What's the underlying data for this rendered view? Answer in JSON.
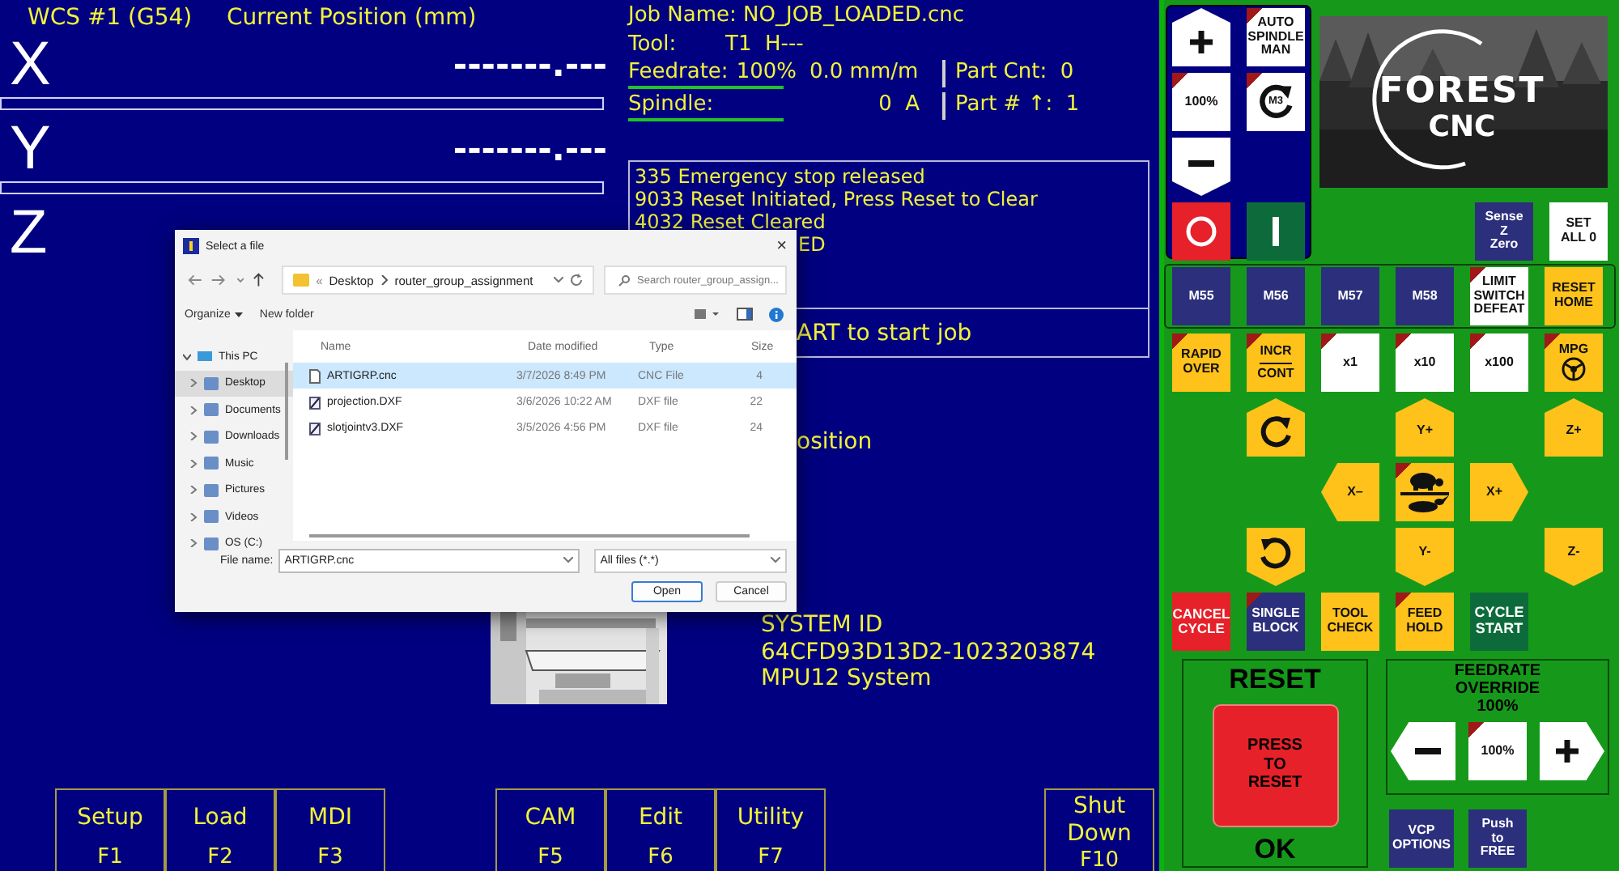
{
  "dro": {
    "wcs": "WCS #1 (G54)",
    "title": "Current Position (mm)",
    "axes": [
      {
        "label": "X",
        "value": "-------.---"
      },
      {
        "label": "Y",
        "value": "-------.---"
      },
      {
        "label": "Z"
      }
    ]
  },
  "job": {
    "name": "Job Name: NO_JOB_LOADED.cnc",
    "tool_label": "Tool:",
    "tool": "T1  H---",
    "feed_label": "Feedrate:",
    "feed_pct": "100%",
    "feed_rate": "0.0 mm/m",
    "part_cnt": "Part Cnt:  0",
    "spindle_label": "Spindle:",
    "spindle": "0  A",
    "part_no": "Part # ↑:  1"
  },
  "messages": [
    {
      "text": "335 Emergency stop released",
      "clipped_left": false
    },
    {
      "text": "9033 Reset Initiated, Press Reset to Clear",
      "clipped_left": false
    },
    {
      "text": "4032 Reset Cleared",
      "clipped_left": false
    },
    {
      "text": "ED",
      "clipped_left": true
    }
  ],
  "status": {
    "text": "ART to start job",
    "clipped_left": true
  },
  "prompt": {
    "text": "osition",
    "clipped_left": true
  },
  "system": [
    "SYSTEM ID",
    "64CFD93D13D2-1023203874",
    "MPU12 System"
  ],
  "fkey_groups": [
    [
      {
        "label": "Setup",
        "key": "F1"
      },
      {
        "label": "Load",
        "key": "F2"
      },
      {
        "label": "MDI",
        "key": "F3"
      }
    ],
    [
      {
        "label": "CAM",
        "key": "F5"
      },
      {
        "label": "Edit",
        "key": "F6"
      },
      {
        "label": "Utility",
        "key": "F7"
      }
    ],
    [
      {
        "label": "Shut Down",
        "key": "F10"
      }
    ]
  ],
  "dialog": {
    "title": "Select a file",
    "close": "×",
    "path_prefix": "«",
    "path": [
      "Desktop",
      "router_group_assignment"
    ],
    "search_placeholder": "Search router_group_assign...",
    "toolbar": [
      "Organize",
      "New folder"
    ],
    "nav": [
      {
        "label": "This PC",
        "expanded": true,
        "selected": false,
        "children": [
          {
            "label": "Desktop",
            "expanded": false,
            "selected": true
          },
          {
            "label": "Documents",
            "expanded": false,
            "selected": false
          },
          {
            "label": "Downloads",
            "expanded": false,
            "selected": false
          },
          {
            "label": "Music",
            "expanded": false,
            "selected": false
          },
          {
            "label": "Pictures",
            "expanded": false,
            "selected": false
          },
          {
            "label": "Videos",
            "expanded": false,
            "selected": false
          },
          {
            "label": "OS (C:)",
            "expanded": false,
            "selected": false
          }
        ]
      }
    ],
    "columns": [
      "Name",
      "Date modified",
      "Type",
      "Size"
    ],
    "files": [
      {
        "name": "ARTIGRP.cnc",
        "date": "3/7/2026 8:49 PM",
        "type": "CNC File",
        "size": "4",
        "kind": "cnc",
        "selected": true
      },
      {
        "name": "projection.DXF",
        "date": "3/6/2026 10:22 AM",
        "type": "DXF file",
        "size": "22",
        "kind": "dxf",
        "selected": false
      },
      {
        "name": "slotjointv3.DXF",
        "date": "3/5/2026 4:56 PM",
        "type": "DXF file",
        "size": "24",
        "kind": "dxf",
        "selected": false
      }
    ],
    "file_name_label": "File name:",
    "file_name": "ARTIGRP.cnc",
    "filter": "All files (*.*)",
    "buttons": [
      "Open",
      "Cancel"
    ]
  },
  "spindle_pad": [
    {
      "kind": "increase"
    },
    {
      "kind": "toggle",
      "lines": [
        "AUTO",
        "SPINDLE",
        "MAN"
      ],
      "indicator": true
    },
    {
      "kind": "toggle",
      "lines": [
        "100%"
      ],
      "indicator": true
    },
    {
      "kind": "spindledir",
      "lines": [
        "M3"
      ],
      "indicator": true
    },
    {
      "kind": "decrease"
    },
    {
      "kind": "off",
      "indicator": false
    },
    {
      "kind": "on",
      "indicator": false
    }
  ],
  "logo": {
    "lines": [
      "FOREST",
      "CNC"
    ]
  },
  "zero_buttons": [
    {
      "kind": "option",
      "lines": [
        "Sense",
        "Z",
        "Zero"
      ],
      "indicator": false
    },
    {
      "kind": "toggle",
      "lines": [
        "SET",
        "ALL 0"
      ],
      "indicator": false
    }
  ],
  "m_buttons": [
    {
      "kind": "option",
      "lines": [
        "M55"
      ],
      "indicator": false
    },
    {
      "kind": "option",
      "lines": [
        "M56"
      ],
      "indicator": false
    },
    {
      "kind": "option",
      "lines": [
        "M57"
      ],
      "indicator": false
    },
    {
      "kind": "option",
      "lines": [
        "M58"
      ],
      "indicator": false
    },
    {
      "kind": "toggle",
      "lines": [
        "LIMIT",
        "SWITCH",
        "DEFEAT"
      ],
      "indicator": true
    },
    {
      "kind": "action",
      "lines": [
        "RESET",
        "HOME"
      ],
      "indicator": false
    }
  ],
  "jog_rows": [
    [
      {
        "kind": "action",
        "lines": [
          "RAPID",
          "OVER"
        ],
        "indicator": true
      },
      {
        "kind": "ratio",
        "lines": [
          "INCR",
          "CONT"
        ],
        "indicator": true
      },
      {
        "kind": "toggle",
        "lines": [
          "x1"
        ],
        "indicator": true
      },
      {
        "kind": "toggle",
        "lines": [
          "x10"
        ],
        "indicator": true
      },
      {
        "kind": "toggle",
        "lines": [
          "x100"
        ],
        "indicator": true
      },
      {
        "kind": "handwheel",
        "lines": [
          "MPG"
        ],
        "indicator": true
      }
    ],
    [
      {
        "kind": "rotatecw"
      },
      {
        "kind": "jogup",
        "lines": [
          "Y+"
        ]
      },
      {
        "kind": "jogup",
        "lines": [
          "Z+"
        ]
      }
    ],
    [
      {
        "kind": "jogleft",
        "lines": [
          "X–"
        ]
      },
      {
        "kind": "speed",
        "indicator": true
      },
      {
        "kind": "jogright",
        "lines": [
          "X+"
        ]
      }
    ],
    [
      {
        "kind": "rotateccw"
      },
      {
        "kind": "jogdown",
        "lines": [
          "Y-"
        ]
      },
      {
        "kind": "jogdown",
        "lines": [
          "Z-"
        ]
      }
    ],
    [
      {
        "kind": "cancel",
        "lines": [
          "CANCEL",
          "CYCLE"
        ],
        "indicator": false
      },
      {
        "kind": "option",
        "lines": [
          "SINGLE",
          "BLOCK"
        ],
        "indicator": true
      },
      {
        "kind": "action",
        "lines": [
          "TOOL",
          "CHECK"
        ],
        "indicator": false
      },
      {
        "kind": "action",
        "lines": [
          "FEED",
          "HOLD"
        ],
        "indicator": true
      },
      {
        "kind": "start",
        "lines": [
          "CYCLE",
          "START"
        ],
        "indicator": false
      }
    ]
  ],
  "reset_panel": {
    "title": "RESET",
    "button": [
      "PRESS",
      "TO",
      "RESET"
    ],
    "status": "OK"
  },
  "feed_override": {
    "title": [
      "FEEDRATE",
      "OVERRIDE"
    ],
    "value": "100%",
    "buttons": [
      {
        "kind": "lower"
      },
      {
        "kind": "toggle",
        "lines": [
          "100%"
        ],
        "indicator": true
      },
      {
        "kind": "raise"
      }
    ]
  },
  "option_buttons": [
    {
      "kind": "option",
      "lines": [
        "VCP",
        "OPTIONS"
      ],
      "indicator": false
    },
    {
      "kind": "option",
      "lines": [
        "Push",
        "to",
        "FREE"
      ],
      "indicator": false
    }
  ]
}
